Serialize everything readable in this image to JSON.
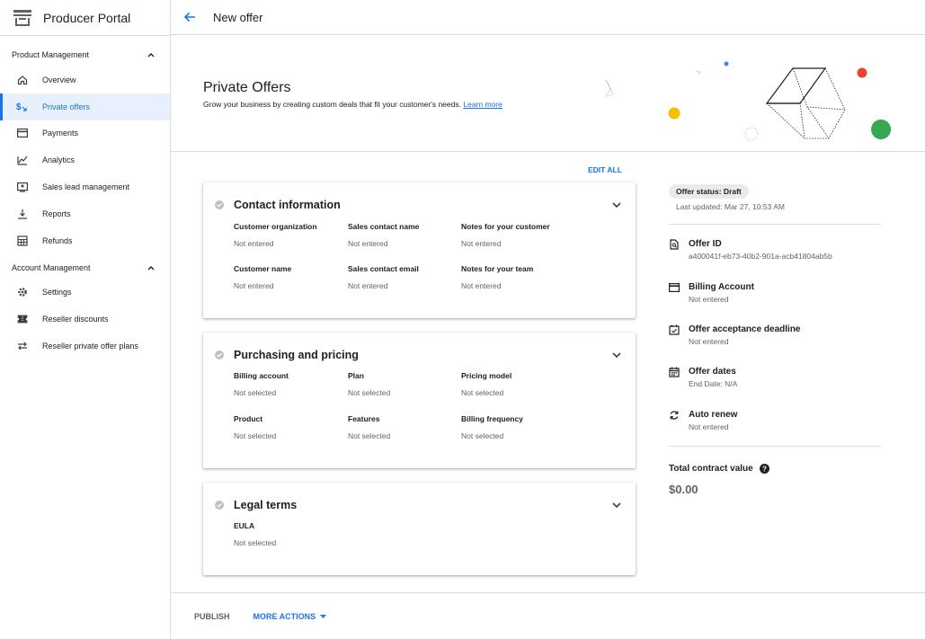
{
  "app": {
    "title": "Producer Portal"
  },
  "topbar": {
    "title": "New offer"
  },
  "sidebar": {
    "sections": [
      {
        "title": "Product Management",
        "items": [
          {
            "label": "Overview",
            "icon": "home-icon"
          },
          {
            "label": "Private offers",
            "icon": "private-offers-icon",
            "active": true
          },
          {
            "label": "Payments",
            "icon": "credit-card-icon"
          },
          {
            "label": "Analytics",
            "icon": "analytics-icon"
          },
          {
            "label": "Sales lead management",
            "icon": "contact-card-icon"
          },
          {
            "label": "Reports",
            "icon": "download-icon"
          },
          {
            "label": "Refunds",
            "icon": "calculator-icon"
          }
        ]
      },
      {
        "title": "Account Management",
        "items": [
          {
            "label": "Settings",
            "icon": "gear-icon"
          },
          {
            "label": "Reseller discounts",
            "icon": "ticket-icon"
          },
          {
            "label": "Reseller private offer plans",
            "icon": "swap-icon"
          }
        ]
      }
    ]
  },
  "hero": {
    "title": "Private Offers",
    "subtitle": "Grow your business by creating custom deals that fit your customer's needs.",
    "link": "Learn more"
  },
  "edit_all": "EDIT ALL",
  "cards": {
    "contact": {
      "title": "Contact information",
      "fields": [
        {
          "label": "Customer organization",
          "value": "Not entered"
        },
        {
          "label": "Sales contact name",
          "value": "Not entered"
        },
        {
          "label": "Notes for your customer",
          "value": "Not entered"
        },
        {
          "label": "Customer name",
          "value": "Not entered"
        },
        {
          "label": "Sales contact email",
          "value": "Not entered"
        },
        {
          "label": "Notes for your team",
          "value": "Not entered"
        }
      ]
    },
    "purchasing": {
      "title": "Purchasing and pricing",
      "fields": [
        {
          "label": "Billing account",
          "value": "Not selected"
        },
        {
          "label": "Plan",
          "value": "Not selected"
        },
        {
          "label": "Pricing model",
          "value": "Not selected"
        },
        {
          "label": "Product",
          "value": "Not selected"
        },
        {
          "label": "Features",
          "value": "Not selected"
        },
        {
          "label": "Billing frequency",
          "value": "Not selected"
        }
      ]
    },
    "legal": {
      "title": "Legal terms",
      "fields": [
        {
          "label": "EULA",
          "value": "Not selected"
        }
      ]
    }
  },
  "summary": {
    "status": "Offer status: Draft",
    "last_updated": "Last updated: Mar 27, 10:53 AM",
    "items": [
      {
        "title": "Offer ID",
        "value": "a400041f-eb73-40b2-901a-acb41804ab5b",
        "icon": "document-search-icon"
      },
      {
        "title": "Billing Account",
        "value": "Not entered",
        "icon": "credit-card-icon"
      },
      {
        "title": "Offer acceptance deadline",
        "value": "Not entered",
        "icon": "event-check-icon"
      },
      {
        "title": "Offer dates",
        "value": "End Date: N/A",
        "icon": "calendar-icon"
      },
      {
        "title": "Auto renew",
        "value": "Not entered",
        "icon": "autorenew-icon"
      }
    ],
    "total_label": "Total contract value",
    "total_value": "$0.00"
  },
  "footer": {
    "publish": "PUBLISH",
    "more_actions": "MORE ACTIONS"
  },
  "colors": {
    "accent": "#1a73e8",
    "active_bg": "#e8f0fe",
    "text": "#202124",
    "muted": "#5f6368"
  }
}
